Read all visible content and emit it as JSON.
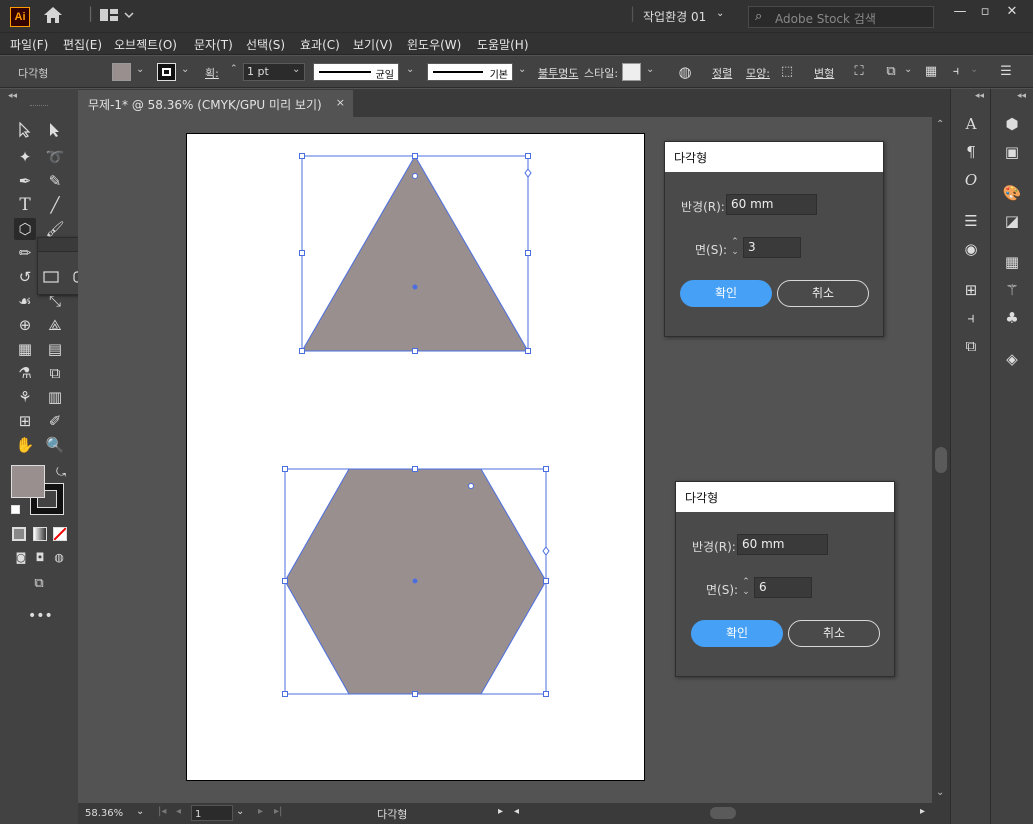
{
  "app": {
    "logo": "Ai",
    "workspace": "작업환경 01",
    "search_placeholder": "Adobe Stock 검색"
  },
  "menu": [
    "파일(F)",
    "편집(E)",
    "오브젝트(O)",
    "문자(T)",
    "선택(S)",
    "효과(C)",
    "보기(V)",
    "윈도우(W)",
    "도움말(H)"
  ],
  "control": {
    "object_type": "다각형",
    "stroke_label": "획:",
    "stroke_value": "1 pt",
    "stroke_profile": "균일",
    "brush": "기본",
    "opacity_label": "불투명도",
    "style_label": "스타일:",
    "align_label": "정렬",
    "shape_label": "모양:",
    "transform_label": "변형",
    "fill_color": "#9a8f8f"
  },
  "document": {
    "tab_title": "무제-1* @ 58.36% (CMYK/GPU 미리 보기)",
    "close": "×"
  },
  "status": {
    "zoom": "58.36%",
    "artboard": "1",
    "info": "다각형"
  },
  "dialogs": [
    {
      "title": "다각형",
      "radius_label": "반경(R):",
      "radius": "60 mm",
      "sides_label": "면(S):",
      "sides": "3",
      "ok": "확인",
      "cancel": "취소"
    },
    {
      "title": "다각형",
      "radius_label": "반경(R):",
      "radius": "60 mm",
      "sides_label": "면(S):",
      "sides": "6",
      "ok": "확인",
      "cancel": "취소"
    }
  ],
  "colors": {
    "shape_fill": "#9a8f8f",
    "selection": "#4c6fe0",
    "accent": "#46a0f5"
  }
}
